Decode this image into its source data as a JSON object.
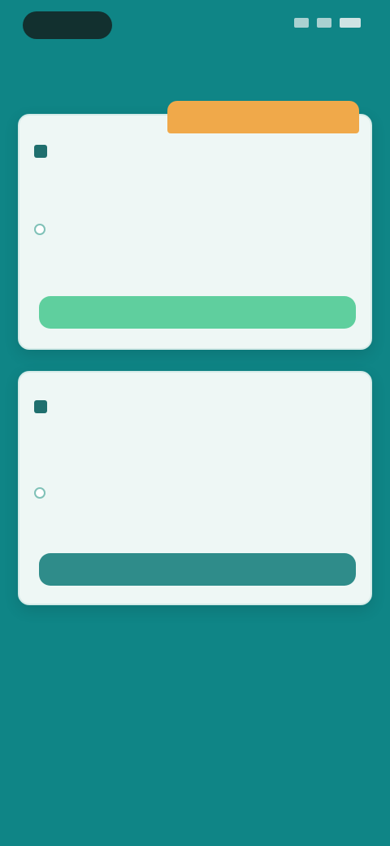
{
  "status_bar": {
    "time": "",
    "icons": [
      "signal-icon",
      "wifi-icon",
      "battery-icon"
    ]
  },
  "section_caption": "",
  "plans": [
    {
      "badge": "",
      "title": "",
      "description": "",
      "rows": [
        {
          "label": "",
          "sub": "",
          "value": ""
        },
        {
          "label": "",
          "sub": "",
          "value": ""
        }
      ],
      "cta_label": ""
    },
    {
      "title": "",
      "description": "",
      "rows": [
        {
          "label": "",
          "sub": "",
          "value": ""
        },
        {
          "label": "",
          "sub": "",
          "value": ""
        }
      ],
      "cta_label": ""
    }
  ],
  "footer_link": "",
  "colors": {
    "background": "#0f8586",
    "card": "#eef7f5",
    "badge": "#f0a94a",
    "primary_cta": "#5fcf9e",
    "secondary_cta": "#2f8c8a"
  }
}
